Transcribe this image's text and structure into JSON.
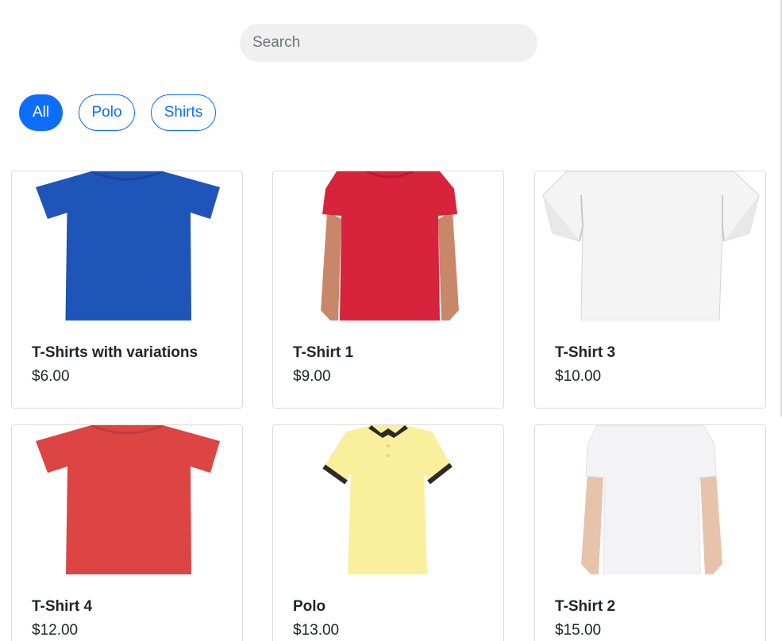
{
  "search": {
    "placeholder": "Search",
    "value": ""
  },
  "filters": [
    {
      "label": "All",
      "active": true
    },
    {
      "label": "Polo",
      "active": false
    },
    {
      "label": "Shirts",
      "active": false
    }
  ],
  "products": [
    {
      "name": "T-Shirts with variations",
      "price": "$6.00",
      "image": "tshirt-flat",
      "color": "#1f55b8"
    },
    {
      "name": "T-Shirt 1",
      "price": "$9.00",
      "image": "tshirt-model",
      "color": "#d7233b"
    },
    {
      "name": "T-Shirt 3",
      "price": "$10.00",
      "image": "tshirt-torso",
      "color": "#f4f4f4"
    },
    {
      "name": "T-Shirt 4",
      "price": "$12.00",
      "image": "tshirt-flat",
      "color": "#dd4444"
    },
    {
      "name": "Polo",
      "price": "$13.00",
      "image": "polo-shirt",
      "color": "#f9ef9d"
    },
    {
      "name": "T-Shirt 2",
      "price": "$15.00",
      "image": "tshirt-model",
      "color": "#f3f3f6"
    }
  ],
  "theme": {
    "accent": "#0d6efd",
    "search_bg": "#f0f0f0",
    "card_border": "#dcdcdc"
  }
}
